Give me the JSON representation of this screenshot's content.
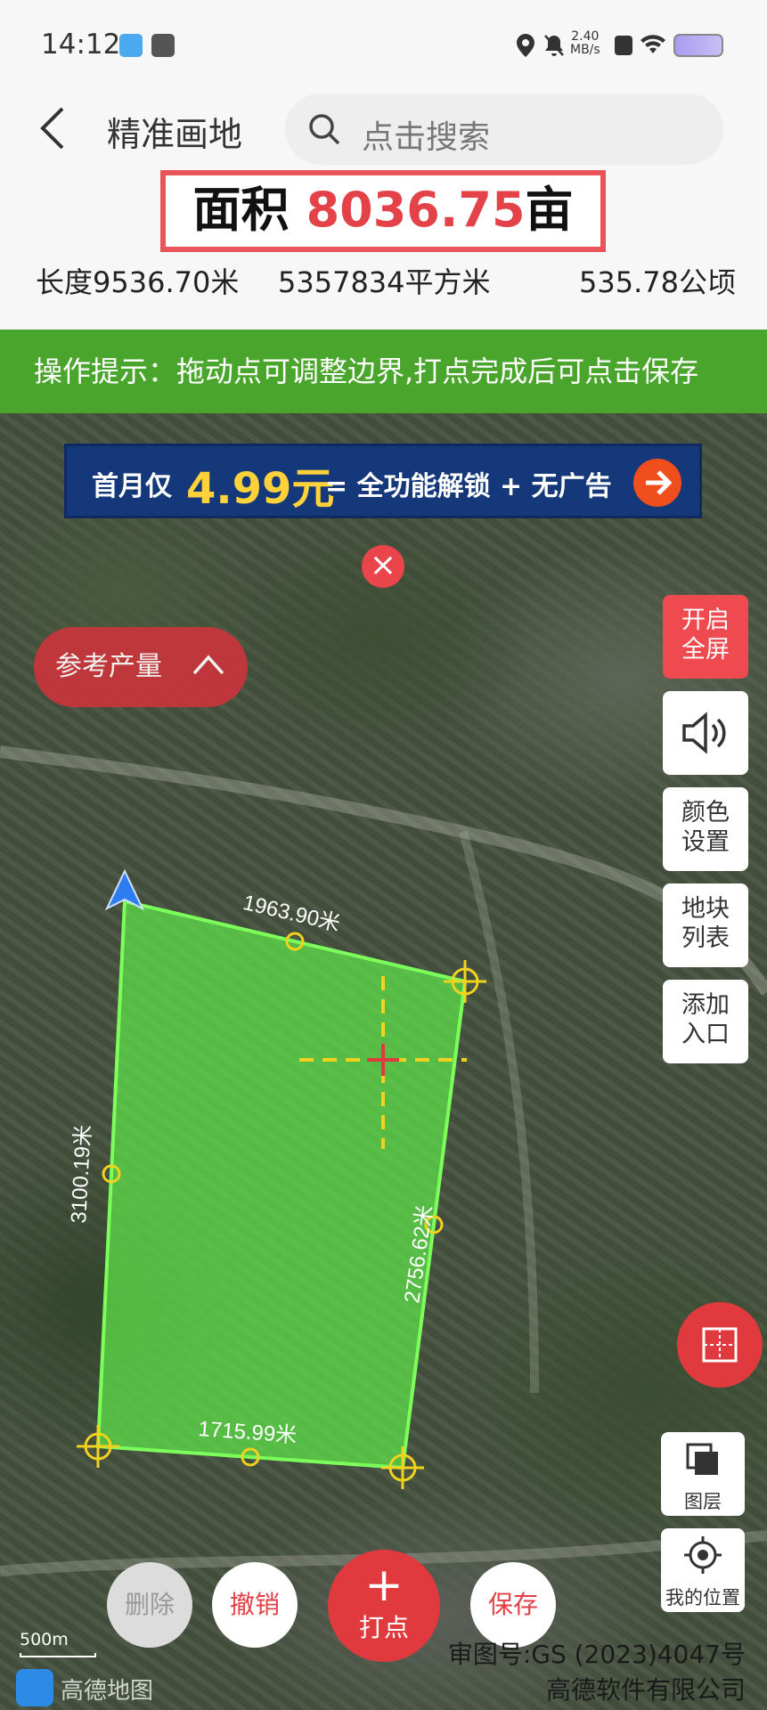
{
  "status_bar": {
    "time": "14:12",
    "network_speed": "2.40",
    "network_unit": "MB/s"
  },
  "header": {
    "title": "精准画地",
    "search_placeholder": "点击搜索"
  },
  "area": {
    "label": "面积",
    "value": "8036.75",
    "unit": "亩"
  },
  "metrics": {
    "length": "长度9536.70米",
    "square_meters": "5357834平方米",
    "hectares": "535.78公顷"
  },
  "tip": "操作提示：拖动点可调整边界,打点完成后可点击保存",
  "banner": {
    "prefix": "首月仅",
    "price": "4.99元",
    "suffix": "= 全功能解锁 + 无广告"
  },
  "reference_yield": "参考产量",
  "side_buttons": {
    "fullscreen": [
      "开启",
      "全屏"
    ],
    "color_settings": [
      "颜色",
      "设置"
    ],
    "plot_list": [
      "地块",
      "列表"
    ],
    "add_entry": [
      "添加",
      "入口"
    ]
  },
  "polygon": {
    "edge_top": "1963.90米",
    "edge_left": "3100.19米",
    "edge_right": "2756.62米",
    "edge_bottom": "1715.99米",
    "fill_color": "#5ee64a",
    "stroke_color": "#7cff5a"
  },
  "tools": {
    "layers": "图层",
    "my_location": "我的位置"
  },
  "actions": {
    "delete": "删除",
    "undo": "撤销",
    "add_point": "打点",
    "save": "保存"
  },
  "map": {
    "scale": "500m",
    "provider": "高德地图",
    "review_number": "审图号:GS (2023)4047号",
    "company": "高德软件有限公司"
  },
  "colors": {
    "accent_red": "#e03a3e",
    "tip_green": "#4aa52c",
    "banner_blue": "#14387a",
    "banner_gold": "#ffd23a"
  }
}
